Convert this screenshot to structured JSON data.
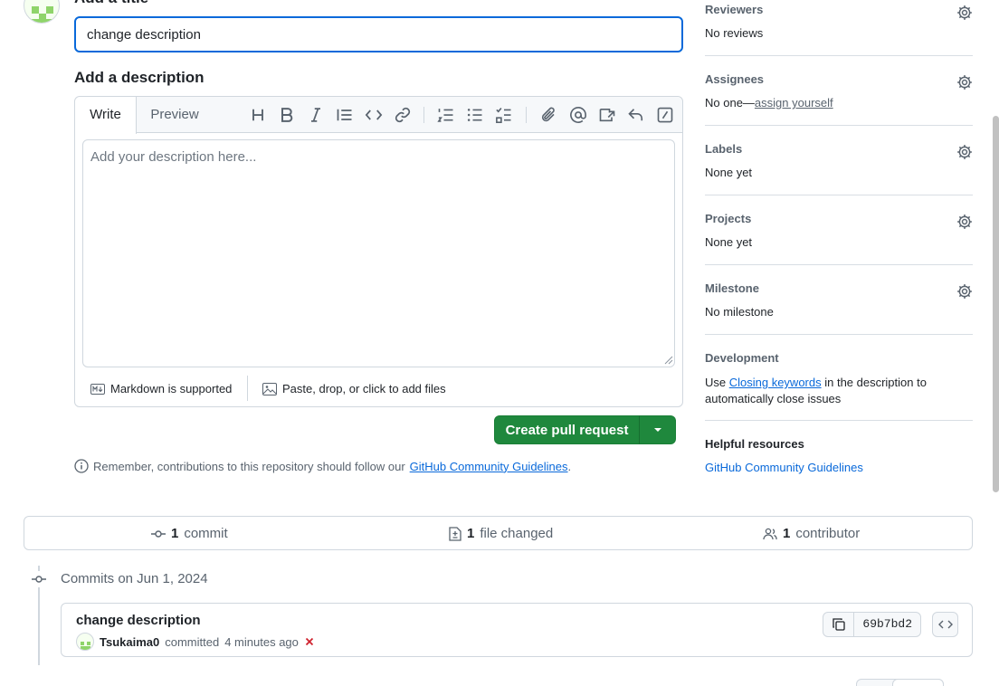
{
  "form": {
    "title_heading": "Add a title",
    "title_value": "change description",
    "description_heading": "Add a description",
    "tabs": [
      {
        "label": "Write"
      },
      {
        "label": "Preview"
      }
    ],
    "description_placeholder": "Add your description here...",
    "markdown_note": "Markdown is supported",
    "attach_note": "Paste, drop, or click to add files",
    "create_button": "Create pull request",
    "reminder_text": "Remember, contributions to this repository should follow our",
    "reminder_link": "GitHub Community Guidelines",
    "reminder_end": "."
  },
  "toolbar_icons": [
    "heading-icon",
    "bold-icon",
    "italic-icon",
    "quote-icon",
    "code-icon",
    "link-icon",
    "numbered-list-icon",
    "unordered-list-icon",
    "task-list-icon",
    "attach-icon",
    "mention-icon",
    "cross-reference-icon",
    "reply-icon",
    "slash-commands-icon"
  ],
  "sidebar": {
    "reviewers": {
      "title": "Reviewers",
      "value": "No reviews"
    },
    "assignees": {
      "title": "Assignees",
      "value_prefix": "No one—",
      "value_link": "assign yourself"
    },
    "labels": {
      "title": "Labels",
      "value": "None yet"
    },
    "projects": {
      "title": "Projects",
      "value": "None yet"
    },
    "milestone": {
      "title": "Milestone",
      "value": "No milestone"
    },
    "development": {
      "title": "Development",
      "text_before": "Use ",
      "link": "Closing keywords",
      "text_after": " in the description to",
      "text_line2": "automatically close issues"
    },
    "helpful": {
      "title": "Helpful resources",
      "link": "GitHub Community Guidelines"
    }
  },
  "stats": {
    "commits_count": "1",
    "commits_label": "commit",
    "files_count": "1",
    "files_label": "file changed",
    "contributors_count": "1",
    "contributors_label": "contributor"
  },
  "commits": {
    "date_heading": "Commits on Jun 1, 2024",
    "items": [
      {
        "title": "change description",
        "author": "Tsukaima0",
        "action": "committed",
        "time": "4 minutes ago",
        "sha": "69b7bd2",
        "status": "failed"
      }
    ]
  },
  "colors": {
    "accent": "#0969da",
    "primary_button": "#1f883d",
    "fail": "#cf222e"
  }
}
